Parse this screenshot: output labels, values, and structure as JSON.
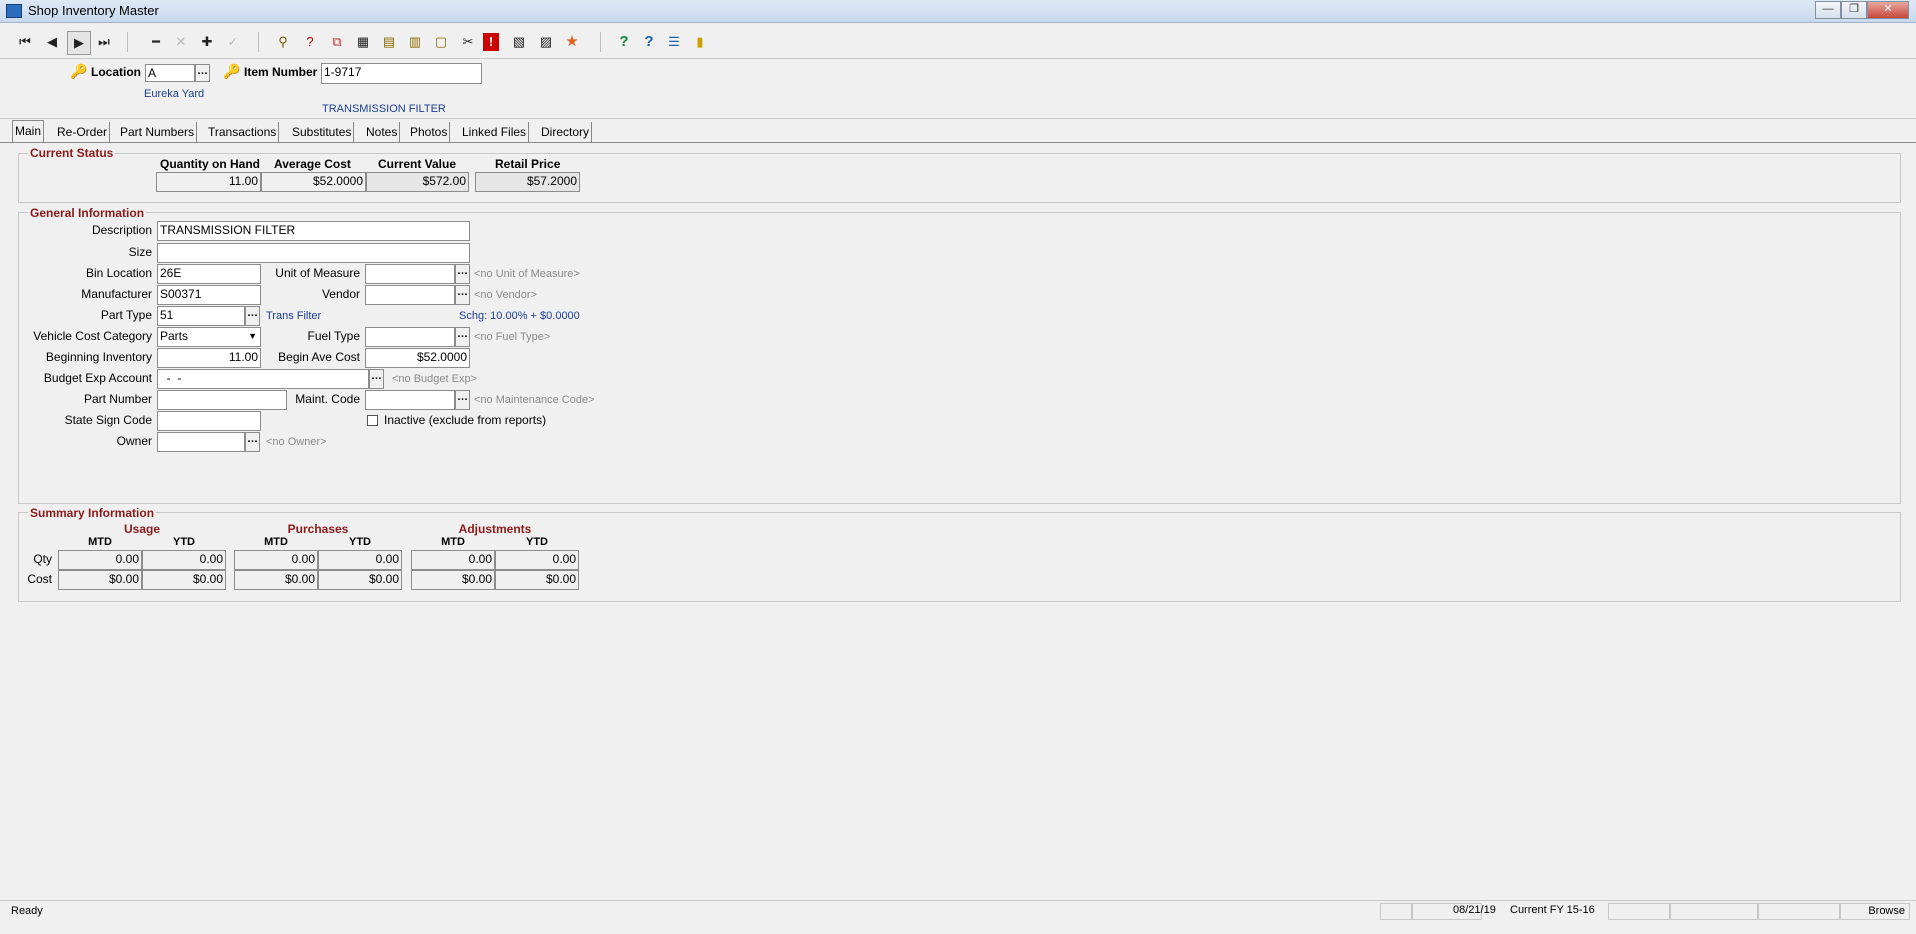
{
  "window": {
    "title": "Shop Inventory Master",
    "buttons": [
      "—",
      "❐",
      "✕"
    ]
  },
  "toolbar": {
    "icons": [
      {
        "name": "first-record-icon",
        "glyph": "⏮"
      },
      {
        "name": "previous-record-icon",
        "glyph": "◀"
      },
      {
        "name": "next-record-icon",
        "glyph": "▶"
      },
      {
        "name": "last-record-icon",
        "glyph": "⏭"
      },
      {
        "name": "delete-record-icon",
        "glyph": "━"
      },
      {
        "name": "cancel-edit-icon",
        "glyph": "✕"
      },
      {
        "name": "add-record-icon",
        "glyph": "✚"
      },
      {
        "name": "save-record-icon",
        "glyph": "✓"
      },
      {
        "name": "filter-icon",
        "glyph": "⚲"
      },
      {
        "name": "query-icon",
        "glyph": "?"
      },
      {
        "name": "copy-record-icon",
        "glyph": "⧉"
      },
      {
        "name": "calculator-icon",
        "glyph": "▦"
      },
      {
        "name": "folders-icon",
        "glyph": "▤"
      },
      {
        "name": "documents-icon",
        "glyph": "▥"
      },
      {
        "name": "new-document-icon",
        "glyph": "▢"
      },
      {
        "name": "tools-icon",
        "glyph": "✂"
      },
      {
        "name": "alert-icon",
        "glyph": "!"
      },
      {
        "name": "report-icon",
        "glyph": "▧"
      },
      {
        "name": "pages-icon",
        "glyph": "▨"
      },
      {
        "name": "favorites-icon",
        "glyph": "★"
      },
      {
        "name": "help-icon",
        "glyph": "?"
      },
      {
        "name": "context-help-icon",
        "glyph": "?"
      },
      {
        "name": "list-icon",
        "glyph": "☰"
      },
      {
        "name": "exit-icon",
        "glyph": "▮"
      }
    ]
  },
  "header": {
    "location_label": "Location",
    "location_value": "A",
    "location_name": "Eureka Yard",
    "item_label": "Item Number",
    "item_value": "1-9717",
    "item_name": "TRANSMISSION FILTER"
  },
  "tabs": [
    "Main",
    "Re-Order",
    "Part Numbers",
    "Transactions",
    "Substitutes",
    "Notes",
    "Photos",
    "Linked Files",
    "Directory"
  ],
  "current_status": {
    "title": "Current Status",
    "qty_label": "Quantity on Hand",
    "qty": "11.00",
    "avg_label": "Average Cost",
    "avg": "$52.0000",
    "value_label": "Current Value",
    "value": "$572.00",
    "retail_label": "Retail Price",
    "retail": "$57.2000"
  },
  "general": {
    "title": "General Information",
    "description_label": "Description",
    "description": "TRANSMISSION FILTER",
    "size_label": "Size",
    "size": "",
    "bin_label": "Bin Location",
    "bin": "26E",
    "uom_label": "Unit of Measure",
    "uom": "",
    "uom_hint": "<no Unit of Measure>",
    "mfr_label": "Manufacturer",
    "mfr": "S00371",
    "vendor_label": "Vendor",
    "vendor": "",
    "vendor_hint": "<no Vendor>",
    "part_type_label": "Part Type",
    "part_type": "51",
    "part_type_name": "Trans Filter",
    "surcharge": "Schg: 10.00% + $0.0000",
    "vcc_label": "Vehicle Cost Category",
    "vcc": "Parts",
    "fuel_label": "Fuel Type",
    "fuel": "",
    "fuel_hint": "<no Fuel Type>",
    "beg_inv_label": "Beginning Inventory",
    "beg_inv": "11.00",
    "beg_avg_label": "Begin Ave Cost",
    "beg_avg": "$52.0000",
    "budget_label": "Budget Exp Account",
    "budget": "  -  -",
    "budget_hint": "<no Budget Exp>",
    "part_number_label": "Part Number",
    "part_number": "",
    "maint_label": "Maint. Code",
    "maint": "",
    "maint_hint": "<no Maintenance Code>",
    "inactive_label": "Inactive (exclude from reports)",
    "inactive": false,
    "state_sign_label": "State Sign Code",
    "state_sign": "",
    "owner_label": "Owner",
    "owner": "",
    "owner_hint": "<no Owner>"
  },
  "summary": {
    "title": "Summary Information",
    "groups": [
      "Usage",
      "Purchases",
      "Adjustments"
    ],
    "mtd": "MTD",
    "ytd": "YTD",
    "row_qty": "Qty",
    "row_cost": "Cost",
    "qty": [
      "0.00",
      "0.00",
      "0.00",
      "0.00",
      "0.00",
      "0.00"
    ],
    "cost": [
      "$0.00",
      "$0.00",
      "$0.00",
      "$0.00",
      "$0.00",
      "$0.00"
    ]
  },
  "status": {
    "text": "Ready",
    "date": "08/21/19",
    "fy": "Current FY 15-16",
    "mode": "Browse"
  }
}
